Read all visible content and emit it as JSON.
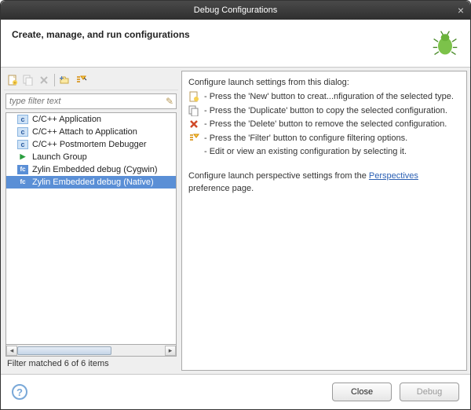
{
  "window": {
    "title": "Debug Configurations"
  },
  "header": {
    "title": "Create, manage, and run configurations"
  },
  "filter": {
    "placeholder": "type filter text"
  },
  "tree": {
    "items": [
      {
        "label": "C/C++ Application",
        "icon": "c"
      },
      {
        "label": "C/C++ Attach to Application",
        "icon": "c"
      },
      {
        "label": "C/C++ Postmortem Debugger",
        "icon": "c"
      },
      {
        "label": "Launch Group",
        "icon": "play"
      },
      {
        "label": "Zylin Embedded debug (Cygwin)",
        "icon": "fc"
      },
      {
        "label": "Zylin Embedded debug (Native)",
        "icon": "fc",
        "selected": true
      }
    ]
  },
  "filter_status": "Filter matched 6 of 6 items",
  "right": {
    "intro": "Configure launch settings from this dialog:",
    "hints": [
      "- Press the 'New' button to creat...nfiguration of the selected type.",
      "- Press the 'Duplicate' button to copy the selected configuration.",
      "- Press the 'Delete' button to remove the selected configuration.",
      "- Press the 'Filter' button to configure filtering options.",
      "- Edit or view an existing configuration by selecting it."
    ],
    "persp_pre": "Configure launch perspective settings from the ",
    "persp_link": "Perspectives",
    "persp_post": " preference page."
  },
  "buttons": {
    "close": "Close",
    "debug": "Debug"
  }
}
